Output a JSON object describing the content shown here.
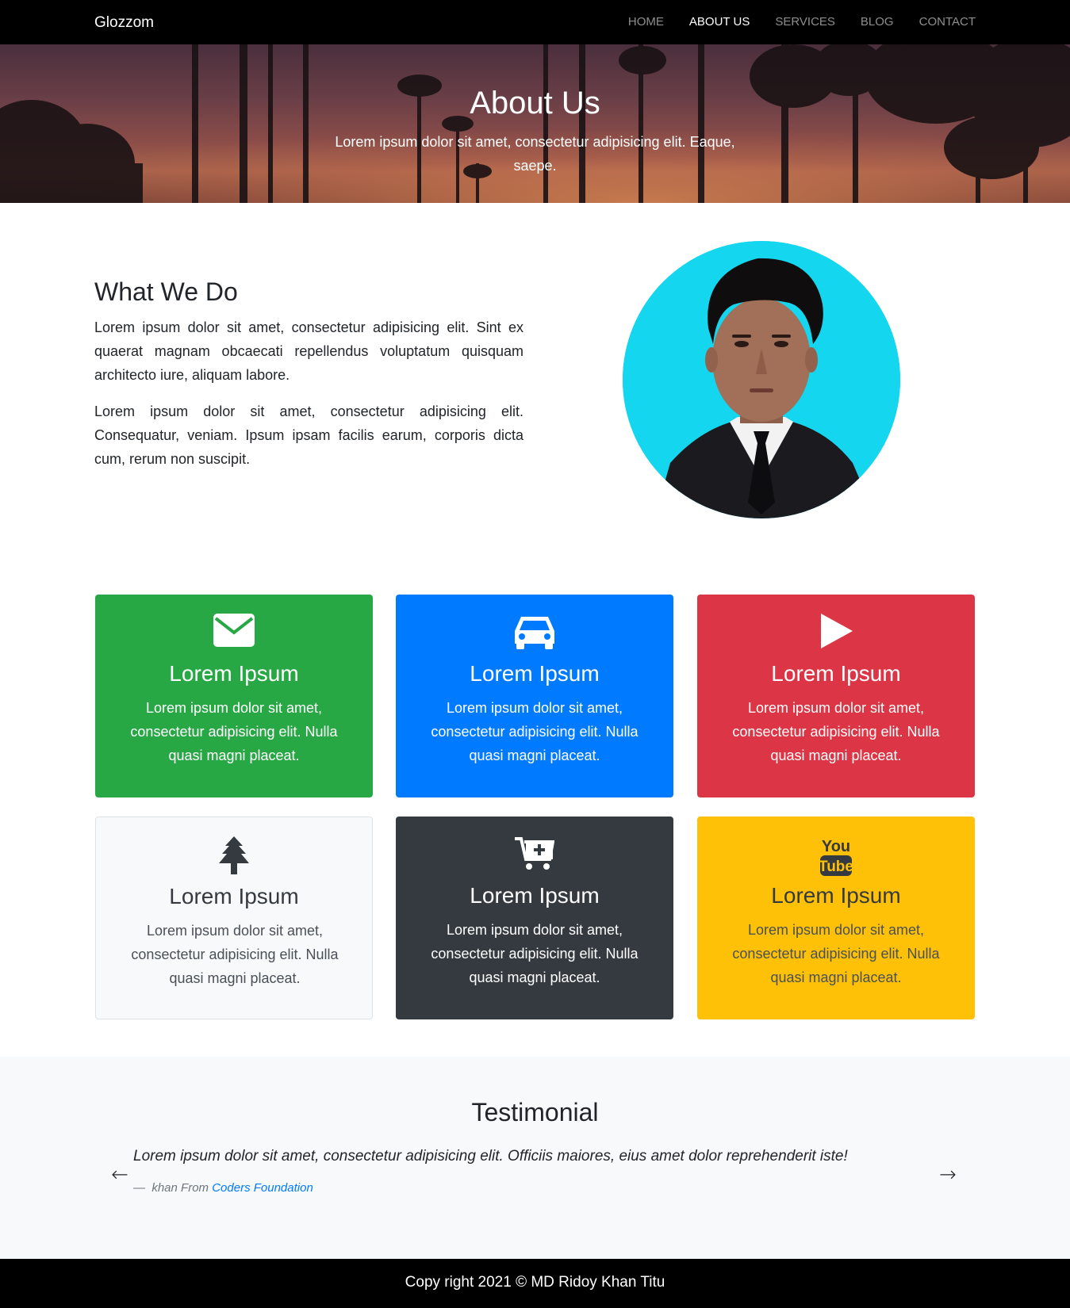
{
  "navbar": {
    "brand": "Glozzom",
    "links": [
      "HOME",
      "ABOUT US",
      "SERVICES",
      "BLOG",
      "CONTACT"
    ],
    "active": "ABOUT US"
  },
  "hero": {
    "title": "About Us",
    "subtitle": "Lorem ipsum dolor sit amet, consectetur adipisicing elit. Eaque, saepe."
  },
  "about": {
    "title": "What We Do",
    "paragraphs": [
      "Lorem ipsum dolor sit amet, consectetur adipisicing elit. Sint ex quaerat magnam obcaecati repellendus voluptatum quisquam architecto iure, aliquam labore.",
      "Lorem ipsum dolor sit amet, consectetur adipisicing elit. Consequatur, veniam. Ipsum ipsam facilis earum, corporis dicta cum, rerum non suscipit."
    ]
  },
  "cards": [
    {
      "icon": "envelope-icon",
      "title": "Lorem Ipsum",
      "text": "Lorem ipsum dolor sit amet, consectetur adipisicing elit. Nulla quasi magni placeat.",
      "color": "#28a745"
    },
    {
      "icon": "car-icon",
      "title": "Lorem Ipsum",
      "text": "Lorem ipsum dolor sit amet, consectetur adipisicing elit. Nulla quasi magni placeat.",
      "color": "#007bff"
    },
    {
      "icon": "play-icon",
      "title": "Lorem Ipsum",
      "text": "Lorem ipsum dolor sit amet, consectetur adipisicing elit. Nulla quasi magni placeat.",
      "color": "#dc3545"
    },
    {
      "icon": "tree-icon",
      "title": "Lorem Ipsum",
      "text": "Lorem ipsum dolor sit amet, consectetur adipisicing elit. Nulla quasi magni placeat.",
      "color": "#f8f9fa"
    },
    {
      "icon": "cart-plus-icon",
      "title": "Lorem Ipsum",
      "text": "Lorem ipsum dolor sit amet, consectetur adipisicing elit. Nulla quasi magni placeat.",
      "color": "#343a40"
    },
    {
      "icon": "youtube-icon",
      "title": "Lorem Ipsum",
      "text": "Lorem ipsum dolor sit amet, consectetur adipisicing elit. Nulla quasi magni placeat.",
      "color": "#ffc107",
      "icon_text": [
        "You",
        "Tube"
      ]
    }
  ],
  "testimonial": {
    "title": "Testimonial",
    "quote": "Lorem ipsum dolor sit amet, consectetur adipisicing elit. Officiis maiores, eius amet dolor reprehenderit iste!",
    "dash": "—",
    "author": "khan From",
    "organization": "Coders Foundation",
    "prev": "←",
    "next": "→"
  },
  "footer": {
    "text": "Copy right 2021 © MD Ridoy Khan Titu"
  }
}
